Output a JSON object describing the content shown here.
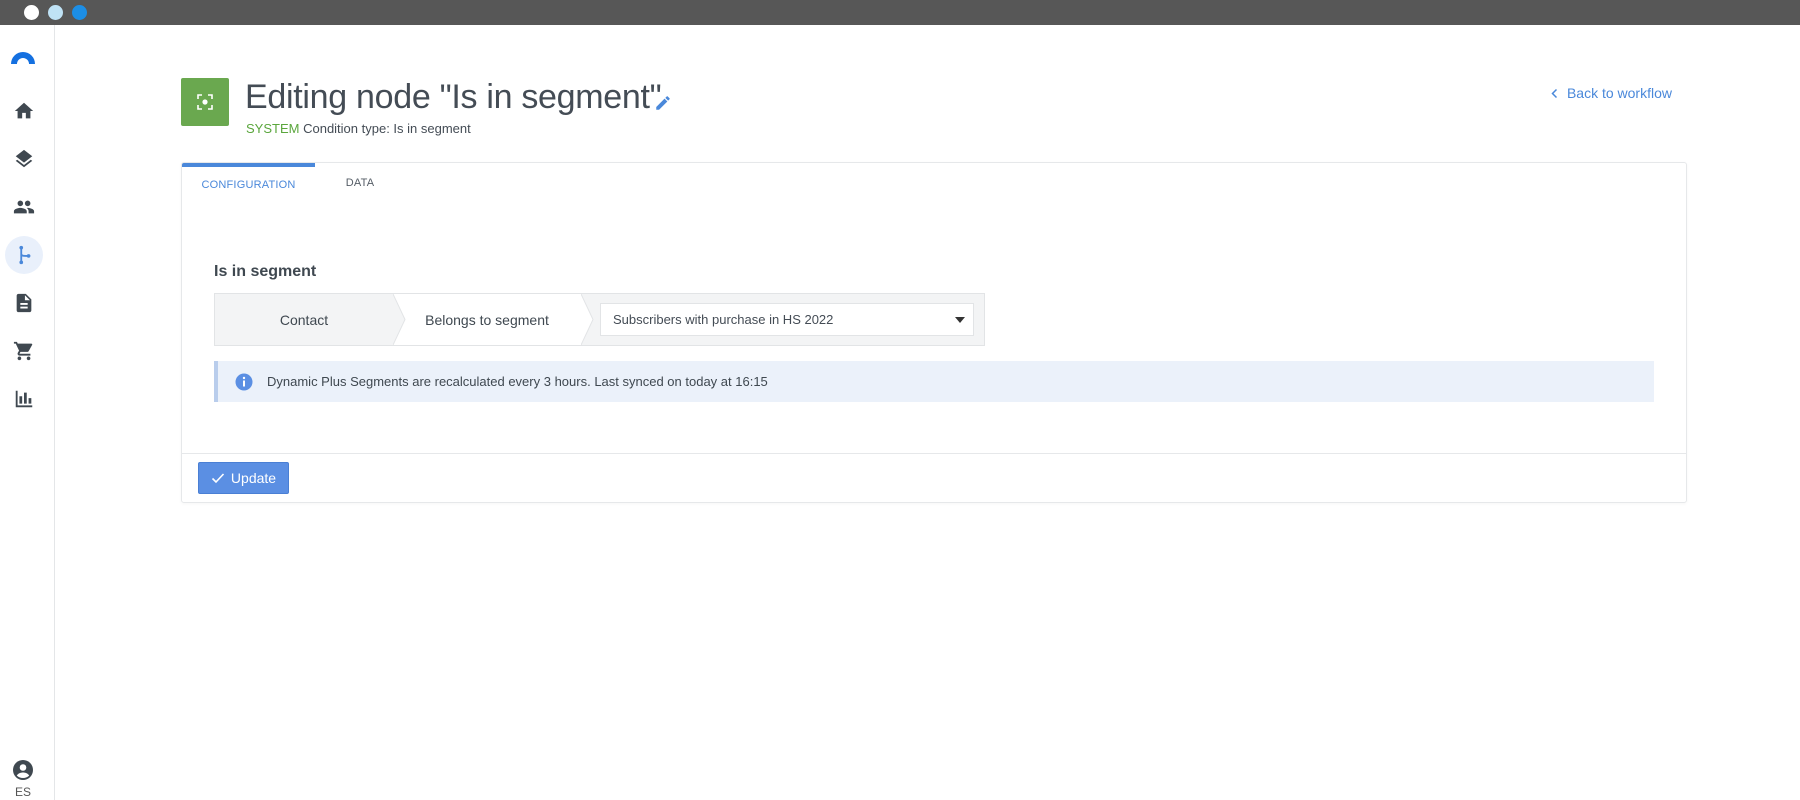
{
  "header": {
    "title": "Editing node \"Is in segment\"",
    "system_label": "SYSTEM",
    "condition_type": "Condition type: Is in segment",
    "back_link": "Back to workflow"
  },
  "nav": {
    "items": [
      "home-icon",
      "layers-icon",
      "people-icon",
      "workflow-icon",
      "document-icon",
      "cart-icon",
      "bar-chart-icon"
    ],
    "active": "workflow-icon",
    "user_lang": "ES"
  },
  "tabs": [
    {
      "label": "CONFIGURATION",
      "active": true
    },
    {
      "label": "DATA",
      "active": false
    }
  ],
  "condition": {
    "title": "Is in segment",
    "subject": "Contact",
    "operator": "Belongs to segment",
    "segment_value": "Subscribers with purchase in HS 2022"
  },
  "info_message": "Dynamic Plus Segments are recalculated every 3 hours. Last synced on today at 16:15",
  "actions": {
    "update_label": "Update"
  },
  "colors": {
    "accent": "#4a88da",
    "node_badge": "#6aa84f",
    "system_text": "#5aa63c",
    "info_bg": "#ebf1fa",
    "button": "#5b8fe3"
  }
}
